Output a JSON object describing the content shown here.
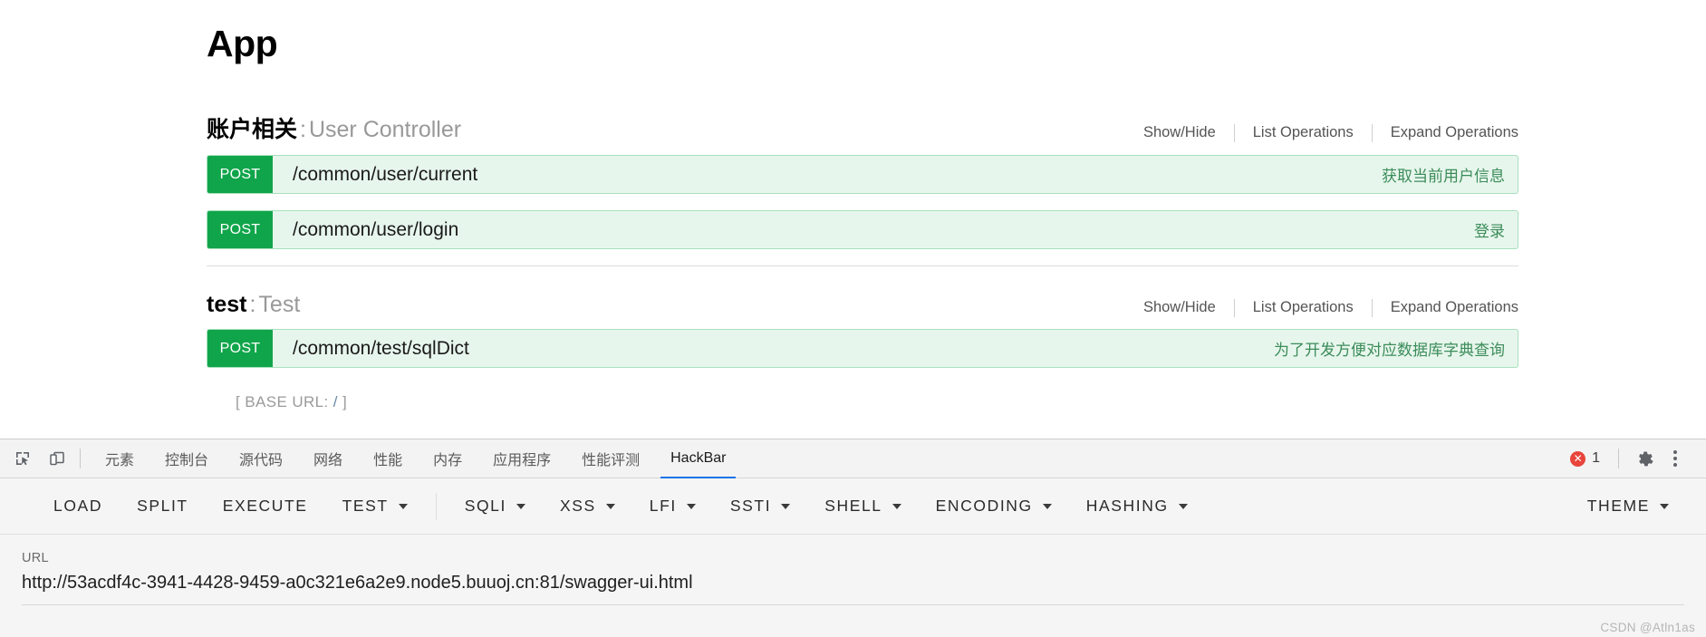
{
  "swagger": {
    "app_title": "App",
    "base_url_prefix": "[ ",
    "base_url_label": "BASE URL",
    "base_url_colon": ": ",
    "base_url_value": "/",
    "base_url_suffix": " ]",
    "ops_links": {
      "show_hide": "Show/Hide",
      "list_operations": "List Operations",
      "expand_operations": "Expand Operations"
    },
    "resources": [
      {
        "name": "账户相关",
        "separator": ":",
        "subname": "User Controller",
        "endpoints": [
          {
            "method": "POST",
            "path": "/common/user/current",
            "description": "获取当前用户信息"
          },
          {
            "method": "POST",
            "path": "/common/user/login",
            "description": "登录"
          }
        ]
      },
      {
        "name": "test",
        "separator": ":",
        "subname": "Test",
        "endpoints": [
          {
            "method": "POST",
            "path": "/common/test/sqlDict",
            "description": "为了开发方便对应数据库字典查询"
          }
        ]
      }
    ],
    "colors": {
      "method_post": "#10a54a",
      "endpoint_bg": "#e7f6ec",
      "endpoint_border": "#a8e0bd",
      "description_text": "#3b8c5a"
    }
  },
  "devtools": {
    "icons": {
      "inspect": "inspect-element-icon",
      "device": "device-toolbar-icon"
    },
    "tabs": [
      {
        "label": "元素",
        "active": false
      },
      {
        "label": "控制台",
        "active": false
      },
      {
        "label": "源代码",
        "active": false
      },
      {
        "label": "网络",
        "active": false
      },
      {
        "label": "性能",
        "active": false
      },
      {
        "label": "内存",
        "active": false
      },
      {
        "label": "应用程序",
        "active": false
      },
      {
        "label": "性能评测",
        "active": false
      },
      {
        "label": "HackBar",
        "active": true
      }
    ],
    "error_badge": {
      "symbol": "✕",
      "count": "1"
    },
    "settings_icon": "gear-icon",
    "more_icon": "kebab-menu-icon",
    "active_tab_accent": "#1a73e8"
  },
  "hackbar": {
    "buttons": [
      {
        "label": "LOAD",
        "dropdown": false
      },
      {
        "label": "SPLIT",
        "dropdown": false
      },
      {
        "label": "EXECUTE",
        "dropdown": false
      },
      {
        "label": "TEST",
        "dropdown": true
      },
      {
        "label": "SQLI",
        "dropdown": true
      },
      {
        "label": "XSS",
        "dropdown": true
      },
      {
        "label": "LFI",
        "dropdown": true
      },
      {
        "label": "SSTI",
        "dropdown": true
      },
      {
        "label": "SHELL",
        "dropdown": true
      },
      {
        "label": "ENCODING",
        "dropdown": true
      },
      {
        "label": "HASHING",
        "dropdown": true
      }
    ],
    "theme_button": {
      "label": "THEME",
      "dropdown": true
    },
    "url_label": "URL",
    "url_value": "http://53acdf4c-3941-4428-9459-a0c321e6a2e9.node5.buuoj.cn:81/swagger-ui.html"
  },
  "watermark": "CSDN @Atln1as"
}
